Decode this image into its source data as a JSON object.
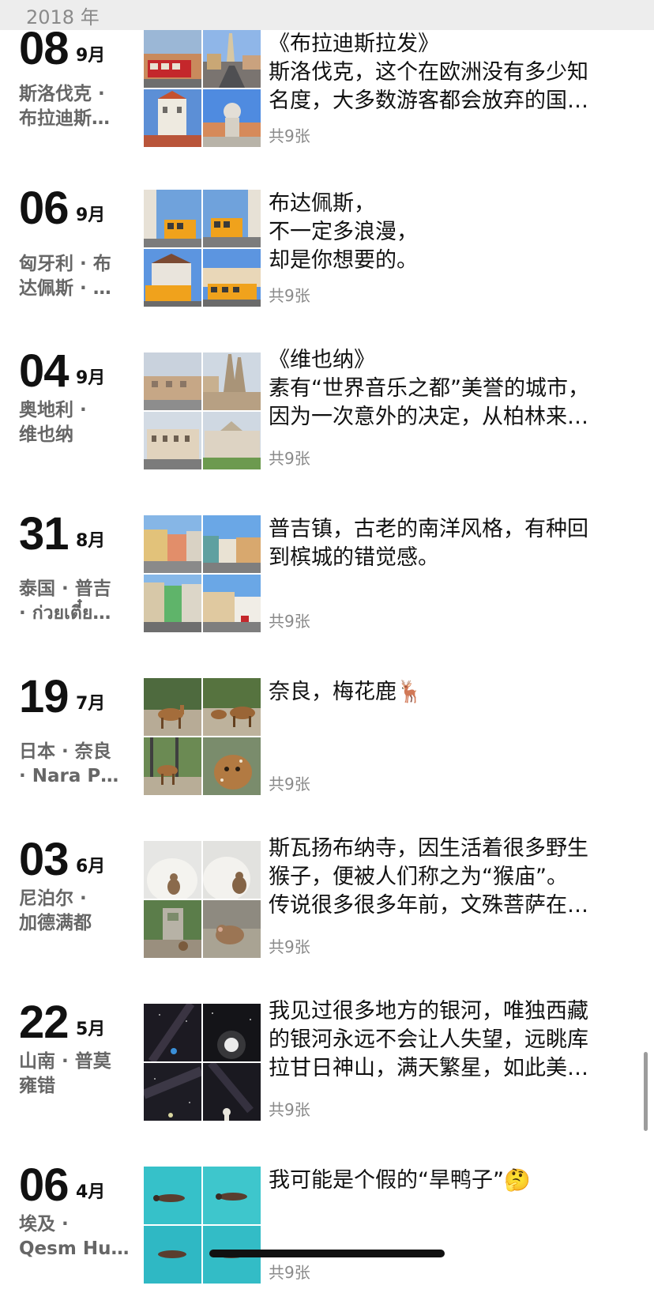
{
  "header": {
    "year": "2018 年"
  },
  "entries": [
    {
      "day": "08",
      "month": "9月",
      "location": "斯洛伐克 ·\n布拉迪斯…",
      "caption": "《布拉迪斯拉发》\n斯洛伐克，这个在欧洲没有多少知\n名度，大多数游客都会放弃的国…",
      "count": "共9张",
      "photos": [
        "street-tram",
        "cathedral-street",
        "castle-tower",
        "statue-plaza"
      ]
    },
    {
      "day": "06",
      "month": "9月",
      "location": "匈牙利 · 布\n达佩斯 · …",
      "caption": "布达佩斯，\n不一定多浪漫，\n却是你想要的。",
      "count": "共9张",
      "photos": [
        "yellow-tram",
        "yellow-tram",
        "tram-station",
        "tram-street"
      ]
    },
    {
      "day": "04",
      "month": "9月",
      "location": "奥地利 ·\n维也纳",
      "caption": "《维也纳》\n素有“世界音乐之都”美誉的城市，\n因为一次意外的决定，从柏林来…",
      "count": "共9张",
      "photos": [
        "street-view",
        "church-spires",
        "palace-building",
        "museum-building"
      ]
    },
    {
      "day": "31",
      "month": "8月",
      "location": "泰国 · 普吉\n· ก่วยเตี๋ย…",
      "caption": "普吉镇，古老的南洋风格，有种回\n到槟城的错觉感。",
      "count": "共9张",
      "photos": [
        "colorful-street",
        "shophouses",
        "colorful-facades",
        "old-town"
      ]
    },
    {
      "day": "19",
      "month": "7月",
      "location": "日本 · 奈良\n· Nara P…",
      "caption": "奈良，梅花鹿🦌",
      "count": "共9张",
      "photos": [
        "deer-park",
        "deer-group",
        "deer-forest",
        "deer-closeup"
      ]
    },
    {
      "day": "03",
      "month": "6月",
      "location": "尼泊尔 ·\n加德满都",
      "caption": "斯瓦扬布纳寺，因生活着很多野生\n猴子，便被人们称之为“猴庙”。\n传说很多很多年前，文殊菩萨在…",
      "count": "共9张",
      "photos": [
        "stupa-monkey",
        "stupa-monkey",
        "temple-tree",
        "monkey-closeup"
      ]
    },
    {
      "day": "22",
      "month": "5月",
      "location": "山南 · 普莫\n雍错",
      "caption": "我见过很多地方的银河，唯独西藏\n的银河永远不会让人失望，远眺库\n拉甘日神山，满天繁星，如此美…",
      "count": "共9张",
      "photos": [
        "night-sky",
        "night-moon",
        "milky-way",
        "night-figure"
      ]
    },
    {
      "day": "06",
      "month": "4月",
      "location": "埃及 ·\nQesm Hu…",
      "caption": "我可能是个假的“旱鸭子”🤔",
      "count": "共9张",
      "photos": [
        "swimmer",
        "swimmer",
        "swimmer",
        "swimmer"
      ]
    }
  ]
}
